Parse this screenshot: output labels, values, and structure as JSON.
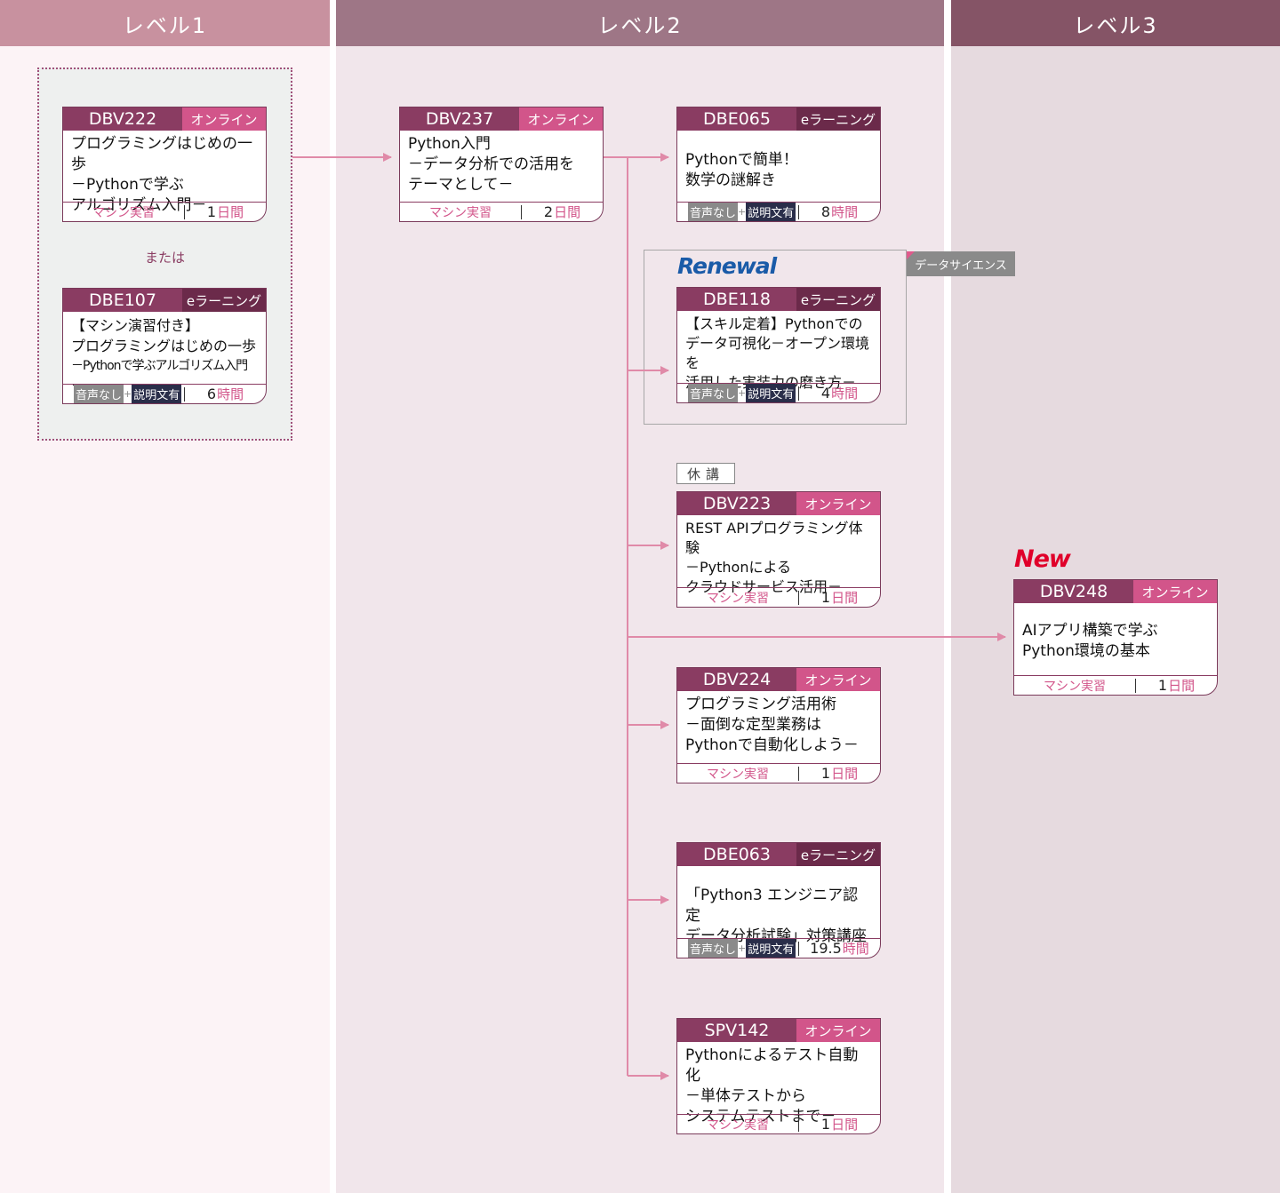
{
  "colors": {
    "col1_bg": "#fcf3f6",
    "col2_bg": "#f1e6eb",
    "col3_bg": "#e6dadf",
    "col1_head": "#c8919f",
    "col2_head": "#9e7686",
    "col3_head": "#855466",
    "arrow": "#e08aa8",
    "card_head": "#8a3c62",
    "online": "#d2558a",
    "elearn": "#6b2a4a"
  },
  "columns": [
    {
      "label": "レベル1"
    },
    {
      "label": "レベル2"
    },
    {
      "label": "レベル3"
    }
  ],
  "labels": {
    "or": "または",
    "data_science": "データサイエンス",
    "kyuko": "休講",
    "renewal": "Renewal",
    "new": "New",
    "badge_a": "音声なし",
    "badge_plus": "+",
    "badge_b": "説明文有"
  },
  "cards": [
    {
      "code": "DBV222",
      "type": "オンライン",
      "title": [
        "プログラミングはじめの一歩",
        "－Pythonで学ぶ",
        "アルゴリズム入門－"
      ],
      "foot": "マシン実習",
      "duration": "1",
      "unit": "日間"
    },
    {
      "code": "DBE107",
      "type": "eラーニング",
      "title": [
        "【マシン演習付き】",
        "プログラミングはじめの一歩",
        "－Pythonで学ぶアルゴリズム入門－"
      ],
      "foot": "",
      "duration": "6",
      "unit": "時間"
    },
    {
      "code": "DBV237",
      "type": "オンライン",
      "title": [
        "Python入門",
        "－データ分析での活用を",
        "テーマとして－"
      ],
      "foot": "マシン実習",
      "duration": "2",
      "unit": "日間"
    },
    {
      "code": "DBE065",
      "type": "eラーニング",
      "title": [
        "",
        "Pythonで簡単！",
        "数学の謎解き"
      ],
      "foot": "",
      "duration": "8",
      "unit": "時間"
    },
    {
      "code": "DBE118",
      "type": "eラーニング",
      "title": [
        "【スキル定着】Pythonでの",
        "データ可視化－オープン環境を",
        "活用した実装力の磨き方－"
      ],
      "foot": "",
      "duration": "4",
      "unit": "時間"
    },
    {
      "code": "DBV223",
      "type": "オンライン",
      "title": [
        "REST APIプログラミング体験",
        "－Pythonによる",
        "クラウドサービス活用－"
      ],
      "foot": "マシン実習",
      "duration": "1",
      "unit": "日間"
    },
    {
      "code": "DBV224",
      "type": "オンライン",
      "title": [
        "プログラミング活用術",
        "－面倒な定型業務は",
        "Pythonで自動化しよう－"
      ],
      "foot": "マシン実習",
      "duration": "1",
      "unit": "日間"
    },
    {
      "code": "DBE063",
      "type": "eラーニング",
      "title": [
        "",
        "「Python3 エンジニア認定",
        "データ分析試験」対策講座"
      ],
      "foot": "",
      "duration": "19.5",
      "unit": "時間"
    },
    {
      "code": "SPV142",
      "type": "オンライン",
      "title": [
        "Pythonによるテスト自動化",
        "－単体テストから",
        "システムテストまで－"
      ],
      "foot": "マシン実習",
      "duration": "1",
      "unit": "日間"
    },
    {
      "code": "DBV248",
      "type": "オンライン",
      "title": [
        "",
        "AIアプリ構築で学ぶ",
        "Python環境の基本"
      ],
      "foot": "マシン実習",
      "duration": "1",
      "unit": "日間"
    }
  ]
}
